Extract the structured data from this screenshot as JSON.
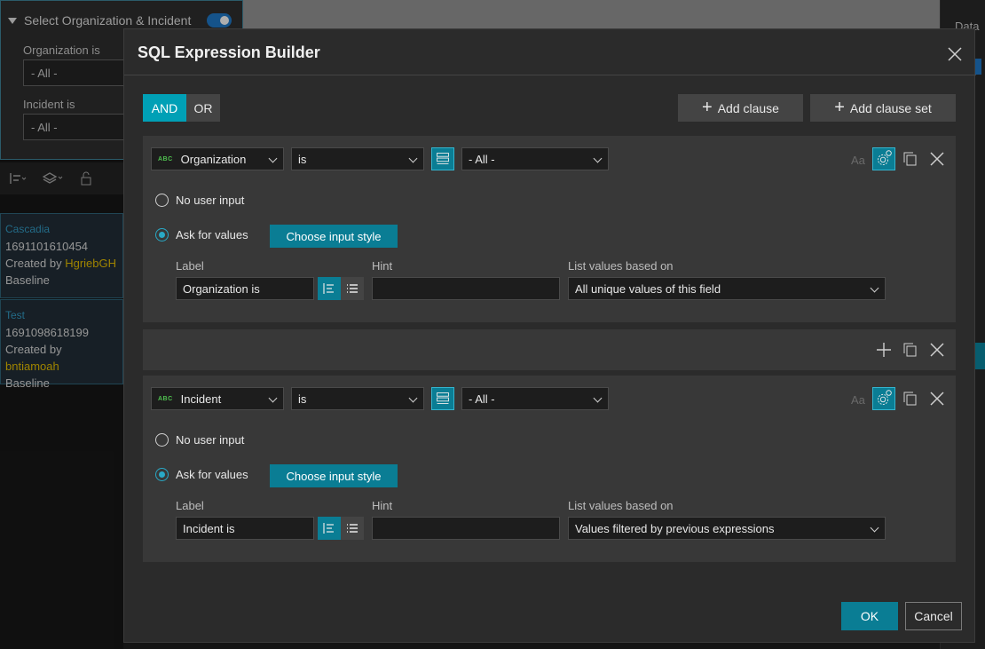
{
  "background": {
    "widget_title": "Select Organization & Incident",
    "org_label": "Organization is",
    "org_value": "- All -",
    "incident_label": "Incident is",
    "incident_value": "- All -",
    "cards": [
      {
        "title": "Cascadia",
        "id": "1691101610454",
        "created_prefix": "Created by ",
        "created_by": "HgriebGH",
        "tag": "Baseline"
      },
      {
        "title": "Test",
        "id": "1691098618199",
        "created_prefix": "Created by ",
        "created_by": "bntiamoah",
        "tag": "Baseline"
      }
    ],
    "right_panel_title": "Data"
  },
  "modal": {
    "title": "SQL Expression Builder",
    "logic": {
      "and_label": "AND",
      "or_label": "OR",
      "selected": "AND"
    },
    "add_clause_label": "Add clause",
    "add_clause_set_label": "Add clause set",
    "clauses": [
      {
        "field": "Organization",
        "field_type_badge": "ABC",
        "operator": "is",
        "value": "- All -",
        "case_label": "Aa",
        "no_input_label": "No user input",
        "ask_values_label": "Ask for values",
        "ask_values_selected": true,
        "choose_style_label": "Choose input style",
        "label_caption": "Label",
        "label_value": "Organization is",
        "hint_caption": "Hint",
        "hint_value": "",
        "list_caption": "List values based on",
        "list_value": "All unique values of this field"
      },
      {
        "field": "Incident",
        "field_type_badge": "ABC",
        "operator": "is",
        "value": "- All -",
        "case_label": "Aa",
        "no_input_label": "No user input",
        "ask_values_label": "Ask for values",
        "ask_values_selected": true,
        "choose_style_label": "Choose input style",
        "label_caption": "Label",
        "label_value": "Incident is",
        "hint_caption": "Hint",
        "hint_value": "",
        "list_caption": "List values based on",
        "list_value": "Values filtered by previous expressions"
      }
    ],
    "ok_label": "OK",
    "cancel_label": "Cancel"
  },
  "colors": {
    "accent": "#0a7d94",
    "accent_bright": "#00a0b6",
    "panel": "#383838",
    "modal_bg": "#2b2b2b"
  }
}
